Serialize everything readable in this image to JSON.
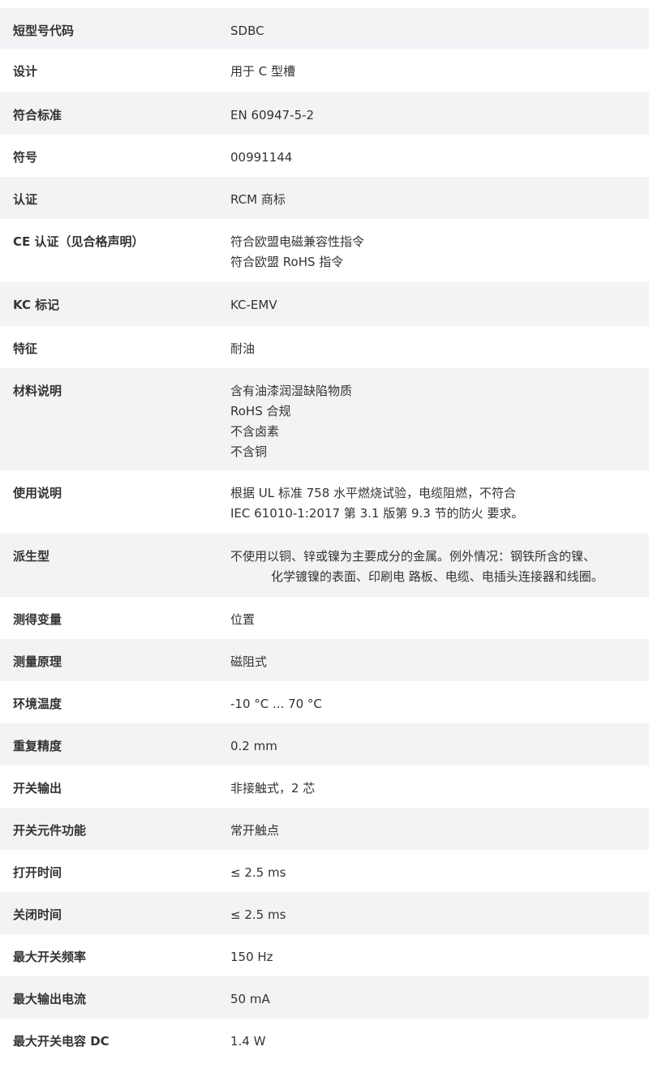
{
  "specs": [
    {
      "label": "短型号代码",
      "lines": [
        "SDBC"
      ],
      "shaded": true
    },
    {
      "label": "设计",
      "lines": [
        "用于 C 型槽"
      ],
      "shaded": false
    },
    {
      "label": "符合标准",
      "lines": [
        "EN 60947-5-2"
      ],
      "shaded": true
    },
    {
      "label": "符号",
      "lines": [
        "00991144"
      ],
      "shaded": false
    },
    {
      "label": "认证",
      "lines": [
        "RCM 商标"
      ],
      "shaded": true
    },
    {
      "label": "CE 认证（见合格声明）",
      "lines": [
        "符合欧盟电磁兼容性指令",
        "符合欧盟 RoHS 指令"
      ],
      "shaded": false
    },
    {
      "label": "KC 标记",
      "lines": [
        "KC-EMV"
      ],
      "shaded": true
    },
    {
      "label": "特征",
      "lines": [
        "耐油"
      ],
      "shaded": false
    },
    {
      "label": "材料说明",
      "lines": [
        "含有油漆润湿缺陷物质",
        "RoHS 合规",
        "不含卤素",
        "不含铜"
      ],
      "shaded": true
    },
    {
      "label": "使用说明",
      "lines": [
        "根据 UL 标准 758 水平燃烧试验，电缆阻燃，不符合",
        "IEC 61010-1:2017 第 3.1 版第 9.3 节的防火 要求。"
      ],
      "shaded": false
    },
    {
      "label": "派生型",
      "lines": [
        "不使用以铜、锌或镍为主要成分的金属。例外情况：钢铁所含的镍、",
        "化学镀镍的表面、印刷电 路板、电缆、电插头连接器和线圈。"
      ],
      "shaded": true
    },
    {
      "label": "测得变量",
      "lines": [
        "位置"
      ],
      "shaded": false
    },
    {
      "label": "测量原理",
      "lines": [
        "磁阻式"
      ],
      "shaded": true
    },
    {
      "label": "环境温度",
      "lines": [
        "-10 °C ... 70 °C"
      ],
      "shaded": false
    },
    {
      "label": "重复精度",
      "lines": [
        "0.2 mm"
      ],
      "shaded": true
    },
    {
      "label": "开关输出",
      "lines": [
        "非接触式，2 芯"
      ],
      "shaded": false
    },
    {
      "label": "开关元件功能",
      "lines": [
        "常开触点"
      ],
      "shaded": true
    },
    {
      "label": "打开时间",
      "lines": [
        "≤ 2.5 ms"
      ],
      "shaded": false
    },
    {
      "label": "关闭时间",
      "lines": [
        "≤ 2.5 ms"
      ],
      "shaded": true
    },
    {
      "label": "最大开关频率",
      "lines": [
        "150 Hz"
      ],
      "shaded": false
    },
    {
      "label": "最大输出电流",
      "lines": [
        "50 mA"
      ],
      "shaded": true
    },
    {
      "label": "最大开关电容 DC",
      "lines": [
        "1.4 W"
      ],
      "shaded": false
    }
  ]
}
